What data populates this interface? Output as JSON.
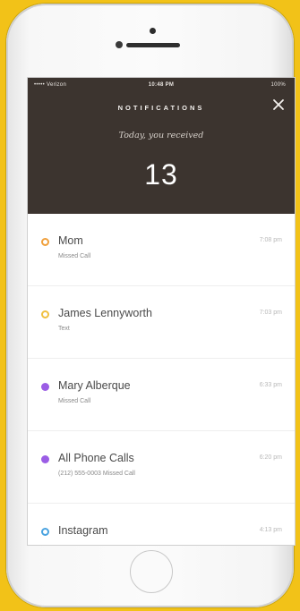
{
  "statusbar": {
    "carrier": "••••• Verizon",
    "time": "10:48 PM",
    "battery": "100%"
  },
  "header": {
    "title": "NOTIFICATIONS",
    "subtitle": "Today, you received",
    "count": "13"
  },
  "notifications": [
    {
      "name": "Mom",
      "detail": "Missed Call",
      "time": "7:08 pm",
      "dot_color": "#f0a03c",
      "dot_style": "ring"
    },
    {
      "name": "James Lennyworth",
      "detail": "Text",
      "time": "7:03 pm",
      "dot_color": "#f0c040",
      "dot_style": "ring"
    },
    {
      "name": "Mary Alberque",
      "detail": "Missed Call",
      "time": "6:33 pm",
      "dot_color": "#9b5de5",
      "dot_style": "filled"
    },
    {
      "name": "All Phone Calls",
      "detail": "(212) 555-0003 Missed Call",
      "time": "6:20 pm",
      "dot_color": "#9b5de5",
      "dot_style": "filled"
    },
    {
      "name": "Instagram",
      "detail": "",
      "time": "4:13 pm",
      "dot_color": "#4aa3e0",
      "dot_style": "ring"
    }
  ],
  "colors": {
    "header_bg": "#3c342f",
    "background": "#f2c218"
  }
}
